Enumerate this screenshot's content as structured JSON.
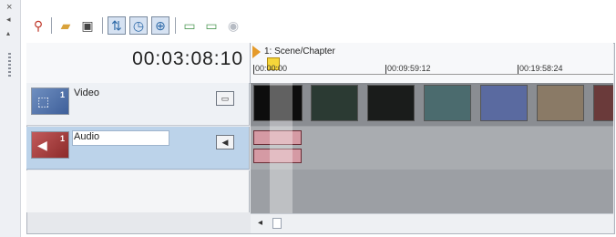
{
  "dock": {
    "close_glyph": "×",
    "pin_glyph": "◂",
    "collapse_glyph": "▴"
  },
  "toolbar": {
    "buttons": [
      {
        "icon": "marker-pin-icon",
        "glyph": "⚲",
        "color": "#c0392b"
      },
      {
        "icon": "folder-open-icon",
        "glyph": "▰",
        "color": "#d9a23a"
      },
      {
        "icon": "save-icon",
        "glyph": "▣",
        "color": "#444444"
      },
      {
        "icon": "split-icon",
        "glyph": "⇅",
        "color": "#2e6aa8"
      },
      {
        "icon": "clock-icon",
        "glyph": "◷",
        "color": "#2e6aa8"
      },
      {
        "icon": "zoom-icon",
        "glyph": "⊕",
        "color": "#2e6aa8"
      },
      {
        "icon": "folder-icon",
        "glyph": "▭",
        "color": "#4f9a56"
      },
      {
        "icon": "folder-new-icon",
        "glyph": "▭",
        "color": "#4f9a56"
      },
      {
        "icon": "disabled-icon",
        "glyph": "◉",
        "color": "#b7bcc4"
      }
    ]
  },
  "timecode": "00:03:08:10",
  "ruler": {
    "chapter_label": "1: Scene/Chapter",
    "ticks": [
      "00:00:00",
      "00:09:59:12",
      "00:19:58:24"
    ]
  },
  "tracks": [
    {
      "name": "Video",
      "number": "1",
      "color": "#3e5f9a",
      "icon": "film-icon",
      "button_icon": "monitor-icon"
    },
    {
      "name": "Audio",
      "number": "1",
      "color": "#8c2a2a",
      "icon": "speaker-icon",
      "button_icon": "speaker-icon"
    }
  ],
  "thumbnails": [
    {
      "color": "#0d0d0d"
    },
    {
      "color": "#2b3a33"
    },
    {
      "color": "#1a1c1b"
    },
    {
      "color": "#4b6b6e"
    },
    {
      "color": "#5a6aa0"
    },
    {
      "color": "#8a7a66"
    },
    {
      "color": "#6a3a3a"
    }
  ],
  "scrollbar": {
    "left_glyph": "◂"
  }
}
